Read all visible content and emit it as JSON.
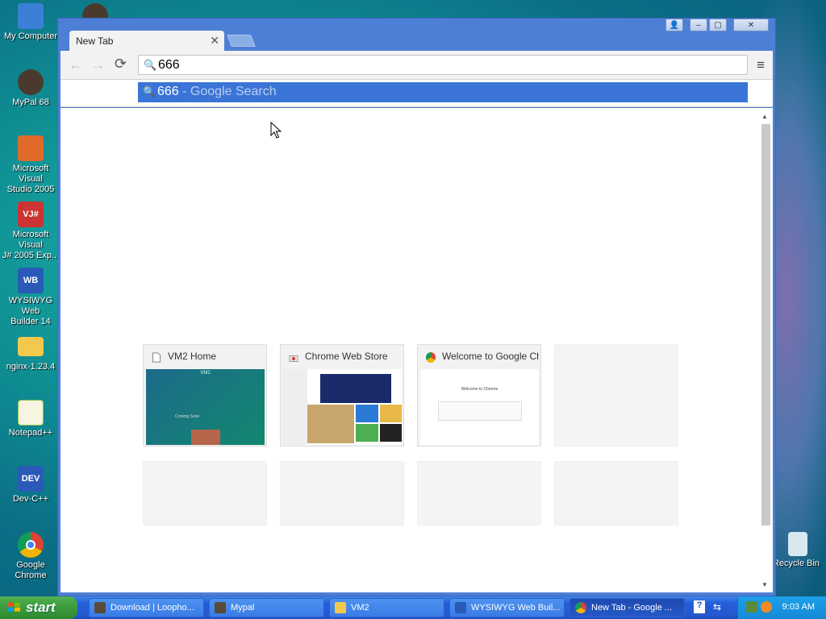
{
  "desktop": {
    "icons": [
      {
        "label": "My Computer",
        "color": "#3b7fd6",
        "glyph": "▣"
      },
      {
        "label": "MyPal 68",
        "color": "#5a4a3a",
        "glyph": "●"
      },
      {
        "label": "Microsoft Visual\nStudio 2005",
        "color": "#e06a2a",
        "glyph": "∞"
      },
      {
        "label": "Microsoft Visual\nJ# 2005 Exp...",
        "color": "#c33",
        "glyph": "VJ#"
      },
      {
        "label": "WYSIWYG Web\nBuilder 14",
        "color": "#2a5ab8",
        "glyph": "WB"
      },
      {
        "label": "nginx-1.23.4",
        "color": "#f2c94c",
        "glyph": ""
      },
      {
        "label": "Notepad++",
        "color": "#8bc34a",
        "glyph": "✎"
      },
      {
        "label": "Dev-C++",
        "color": "#2a5ab8",
        "glyph": "DEV"
      },
      {
        "label": "Google Chrome",
        "color": "#db4437",
        "glyph": "◉"
      }
    ],
    "recycle_bin": "Recycle Bin"
  },
  "browser": {
    "tab_title": "New Tab",
    "tab_close": "✕",
    "window_buttons": {
      "profile": "👤",
      "minimize": "–",
      "maximize": "▢",
      "close": "✕"
    },
    "toolbar": {
      "back": "←",
      "forward": "→",
      "reload": "⟳",
      "menu": "≡"
    },
    "omnibox_value": "666",
    "suggestion": {
      "query": "666",
      "hint": " - Google Search"
    },
    "tiles": [
      {
        "title": "VM2 Home",
        "favicon": "page-icon",
        "thumb": "vm2"
      },
      {
        "title": "Chrome Web Store",
        "favicon": "chrome-store-icon",
        "thumb": "store"
      },
      {
        "title": "Welcome to Google Chrome",
        "favicon": "chrome-icon",
        "thumb": "welcome"
      },
      {
        "title": "",
        "favicon": "",
        "thumb": "empty"
      }
    ],
    "vm2_thumb": {
      "heading": "VM2",
      "sub": "Coming Soon"
    },
    "welcome_thumb": {
      "heading": "Welcome to Chrome"
    }
  },
  "taskbar": {
    "start_label": "start",
    "tasks": [
      {
        "label": "Download | Loopho...",
        "color": "#5a4a3a"
      },
      {
        "label": "Mypal",
        "color": "#5a4a3a"
      },
      {
        "label": "VM2",
        "color": "#f2c94c"
      },
      {
        "label": "WYSIWYG Web Buil...",
        "color": "#2a5ab8"
      },
      {
        "label": "New Tab - Google ...",
        "color": "#db4437"
      }
    ],
    "quick_help": "?",
    "clock": "9:03 AM"
  },
  "colors": {
    "accent": "#3a74d6",
    "titlebar": "#4e7fd6",
    "taskbar": "#245edb"
  }
}
